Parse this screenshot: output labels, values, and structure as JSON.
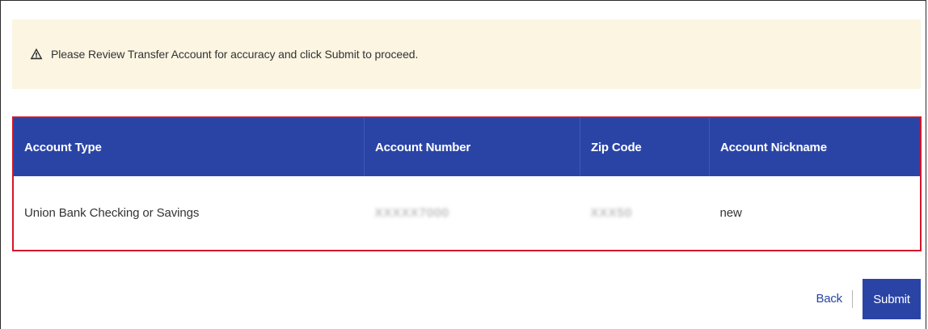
{
  "alert": {
    "icon": "warning-triangle-icon",
    "message": "Please Review Transfer Account for accuracy and click Submit to proceed."
  },
  "table": {
    "headers": [
      "Account Type",
      "Account Number",
      "Zip Code",
      "Account Nickname"
    ],
    "rows": [
      {
        "account_type": "Union Bank Checking or Savings",
        "account_number": "XXXXX7000",
        "zip_code": "XXX50",
        "nickname": "new"
      }
    ]
  },
  "actions": {
    "back_label": "Back",
    "submit_label": "Submit"
  },
  "colors": {
    "header_bg": "#2a44a6",
    "highlight_border": "#d2182a",
    "alert_bg": "#fbf5e2",
    "button_bg": "#2a44a6"
  }
}
